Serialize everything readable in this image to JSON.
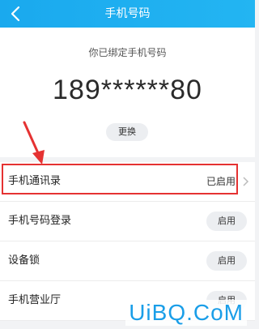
{
  "header": {
    "title": "手机号码"
  },
  "bound": {
    "label": "你已绑定手机号码",
    "phone": "189******80",
    "change_label": "更换"
  },
  "rows": [
    {
      "label": "手机通讯录",
      "status": "已启用"
    },
    {
      "label": "手机号码登录",
      "action": "启用"
    },
    {
      "label": "设备锁",
      "action": "启用"
    },
    {
      "label": "手机营业厅",
      "action": "启用"
    }
  ],
  "watermark": "UiBQ.CoM",
  "colors": {
    "header": "#1aa9ee",
    "highlight": "#e53232",
    "watermark": "#1a9ee8"
  }
}
